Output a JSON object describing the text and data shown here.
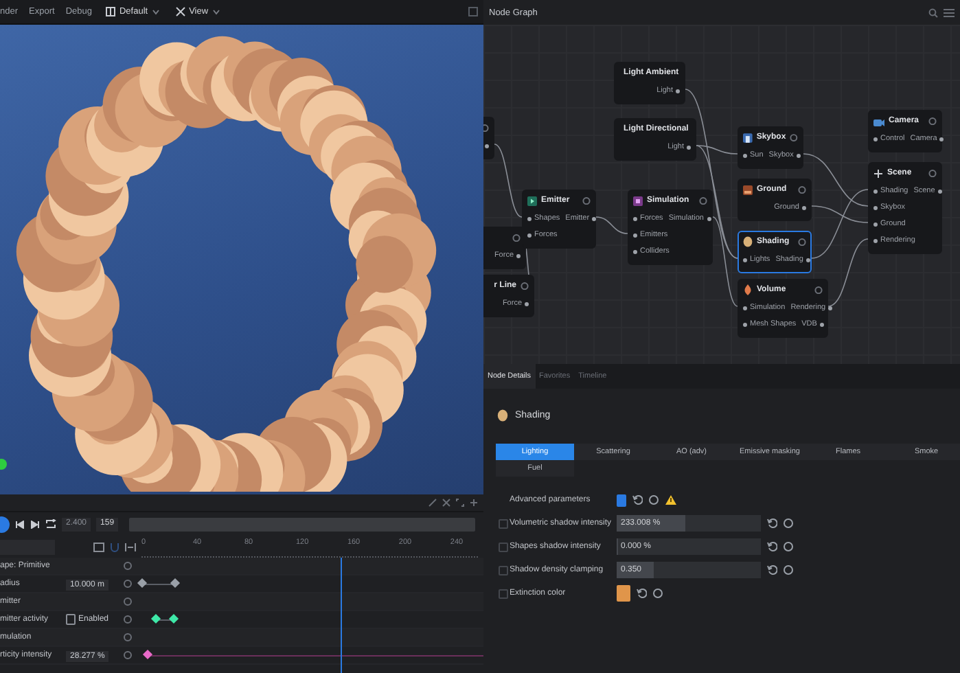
{
  "toolbar": {
    "menus": [
      "nder",
      "Export",
      "Debug"
    ],
    "dropdowns": [
      {
        "label": "Default"
      },
      {
        "label": "View"
      }
    ]
  },
  "viewport": {
    "indicator_on": true
  },
  "timeline": {
    "time": "2.400",
    "frame": "159",
    "ruler": [
      "0",
      "40",
      "80",
      "120",
      "160",
      "200",
      "240"
    ],
    "playhead": {
      "level": 0.61
    },
    "rows": [
      {
        "kind": "group",
        "label": "ape: Primitive"
      },
      {
        "kind": "value",
        "label": "adius",
        "value": "10.000 m",
        "color": "#9aa0a8"
      },
      {
        "kind": "group",
        "label": "mitter"
      },
      {
        "kind": "toggle",
        "label": "mitter activity",
        "checked": false,
        "toggle_label": "Enabled",
        "color": "#3ee8a8"
      },
      {
        "kind": "group",
        "label": "mulation"
      },
      {
        "kind": "value",
        "label": "rticity intensity",
        "value": "28.277 %",
        "color": "#e86ac8"
      }
    ]
  },
  "graph": {
    "title": "Node Graph",
    "nodes": [
      {
        "kind": "partial"
      },
      {
        "kind": "partial",
        "outputs": [
          "Force"
        ]
      },
      {
        "kind": "partial",
        "title": "r Line",
        "outputs": [
          "Force"
        ]
      },
      {
        "kind": "node",
        "title": "Light Ambient",
        "selected": false,
        "outputs": [
          "Light"
        ]
      },
      {
        "kind": "node",
        "title": "Light Directional",
        "selected": false,
        "outputs": [
          "Light"
        ]
      },
      {
        "kind": "node",
        "title": "Emitter",
        "selected": false,
        "inputs": [
          "Shapes",
          "Forces"
        ],
        "outputs": [
          "Emitter"
        ]
      },
      {
        "kind": "node",
        "title": "Simulation",
        "selected": false,
        "inputs": [
          "Forces",
          "Emitters",
          "Colliders"
        ],
        "outputs": [
          "Simulation"
        ]
      },
      {
        "kind": "node",
        "title": "Skybox",
        "selected": false,
        "inputs": [
          "Sun"
        ],
        "outputs": [
          "Skybox"
        ]
      },
      {
        "kind": "node",
        "title": "Ground",
        "selected": false,
        "outputs": [
          "Ground"
        ]
      },
      {
        "kind": "node",
        "title": "Shading",
        "selected": true,
        "inputs": [
          "Lights"
        ],
        "outputs": [
          "Shading"
        ]
      },
      {
        "kind": "node",
        "title": "Volume",
        "selected": false,
        "inputs": [
          "Simulation",
          "Mesh Shapes"
        ],
        "outputs": [
          "Rendering",
          "VDB"
        ]
      },
      {
        "kind": "node",
        "title": "Camera",
        "selected": false,
        "inputs": [
          "Control"
        ],
        "outputs": [
          "Camera"
        ]
      },
      {
        "kind": "node",
        "title": "Scene",
        "selected": false,
        "inputs": [
          "Shading",
          "Skybox",
          "Ground",
          "Rendering"
        ],
        "outputs": [
          "Scene"
        ]
      }
    ]
  },
  "details": {
    "tabs": [
      {
        "label": "Node Details",
        "selected": true
      },
      {
        "label": "Favorites",
        "selected": false
      },
      {
        "label": "Timeline",
        "selected": false
      }
    ],
    "heading": "Shading",
    "subtabs": [
      {
        "label": "Lighting",
        "selected": true
      },
      {
        "label": "Scattering",
        "selected": false
      },
      {
        "label": "AO (adv)",
        "selected": false
      },
      {
        "label": "Emissive masking",
        "selected": false
      },
      {
        "label": "Flames",
        "selected": false
      },
      {
        "label": "Smoke",
        "selected": false
      },
      {
        "label": "Fuel",
        "selected": false
      }
    ],
    "params": [
      {
        "kind": "checkbox",
        "label": "Advanced parameters",
        "checked": true,
        "warning": true
      },
      {
        "kind": "slider",
        "label": "Volumetric shadow intensity",
        "checked": false,
        "value": "233.008 %",
        "level": 0.48
      },
      {
        "kind": "slider",
        "label": "Shapes shadow intensity",
        "checked": false,
        "value": "0.000 %",
        "level": 0
      },
      {
        "kind": "slider",
        "label": "Shadow density clamping",
        "checked": false,
        "value": "0.350",
        "level": 0.26
      },
      {
        "kind": "color",
        "label": "Extinction color",
        "checked": false,
        "color": "#e0954a"
      }
    ]
  }
}
